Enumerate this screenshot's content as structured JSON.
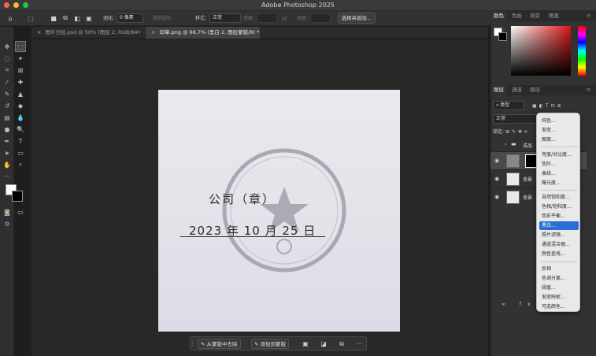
{
  "window": {
    "title": "Adobe Photoshop 2025",
    "traffic_lights": [
      "#ff5f57",
      "#febc2e",
      "#28c840"
    ]
  },
  "options_bar": {
    "feather_label": "羽化:",
    "feather_value": "0 像素",
    "antialias_label": "消除锯齿",
    "style_label": "样式:",
    "style_value": "正常",
    "width_label": "宽度:",
    "height_label": "高度:",
    "select_and_mask_label": "选择并遮住..."
  },
  "tabs": [
    {
      "label": "图片分层.psd @ 50% (图层 2, RGB/8#)",
      "close": "×"
    },
    {
      "label": "印章.png @ 66.7% (黑白 2, 图层蒙版/8) *",
      "close": "×"
    }
  ],
  "document": {
    "line1": "公司（章）",
    "line2": "2023 年 10 月 25 日"
  },
  "taskbar": {
    "remove_from_mask": "从蒙版中去除",
    "add_to_mask": "添加到蒙版",
    "more": "···"
  },
  "panels": {
    "color_tabs": [
      "颜色",
      "色板",
      "渐变",
      "图案"
    ],
    "layers_tabs": [
      "图层",
      "通道",
      "路径"
    ],
    "filter_label": "类型",
    "blend_mode": "正常",
    "lock_label": "锁定:",
    "layers": [
      {
        "name": "成品"
      },
      {
        "name": ""
      },
      {
        "name": "背景"
      },
      {
        "name": "背景"
      }
    ]
  },
  "adjustment_menu": {
    "items": [
      "纯色...",
      "渐变...",
      "图案...",
      "亮度/对比度...",
      "色阶...",
      "曲线...",
      "曝光度...",
      "自然饱和度...",
      "色相/饱和度...",
      "色彩平衡...",
      "黑白...",
      "照片滤镜...",
      "通道混合器...",
      "颜色查找...",
      "反相",
      "色调分离...",
      "阈值...",
      "渐变映射...",
      "可选颜色..."
    ],
    "selected": "黑白..."
  }
}
